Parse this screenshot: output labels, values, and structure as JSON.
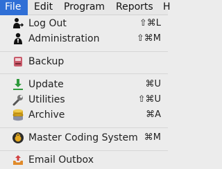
{
  "menubar": {
    "items": [
      "File",
      "Edit",
      "Program",
      "Reports",
      "H"
    ]
  },
  "menu": {
    "log_out": {
      "label": "Log Out",
      "shortcut": "⇧⌘L",
      "icon": "user-exit-icon"
    },
    "administration": {
      "label": "Administration",
      "shortcut": "⇧⌘M",
      "icon": "admin-person-icon"
    },
    "backup": {
      "label": "Backup",
      "icon": "backup-drive-icon"
    },
    "update": {
      "label": "Update",
      "shortcut": "⌘U",
      "icon": "download-arrow-icon"
    },
    "utilities": {
      "label": "Utilities",
      "shortcut": "⇧⌘U",
      "icon": "wrench-icon"
    },
    "archive": {
      "label": "Archive",
      "shortcut": "⌘A",
      "icon": "database-stack-icon"
    },
    "master_coding": {
      "label": "Master Coding System",
      "shortcut": "⌘M",
      "icon": "coding-badge-icon"
    },
    "email_outbox": {
      "label": "Email Outbox",
      "icon": "outbox-tray-icon"
    }
  },
  "colors": {
    "menu_bg": "#ececec",
    "active_menu": "#2f6fd6",
    "separator": "#d6d6d6"
  }
}
